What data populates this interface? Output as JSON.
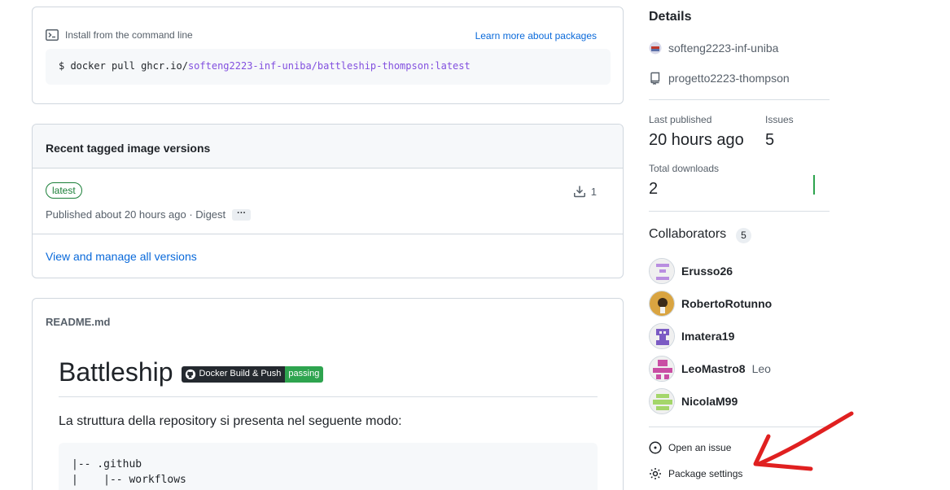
{
  "install": {
    "label": "Install from the command line",
    "learn_link": "Learn more about packages",
    "cmd_prefix": "$ docker pull ghcr.io/",
    "cmd_repo": "softeng2223-inf-uniba/battleship-thompson:latest"
  },
  "versions": {
    "title": "Recent tagged image versions",
    "tag": "latest",
    "published": "Published about 20 hours ago · Digest",
    "digest_btn": "···",
    "downloads": "1",
    "view_all": "View and manage all versions"
  },
  "readme": {
    "filename": "README.md",
    "title": "Battleship",
    "badge_left": "Docker Build & Push",
    "badge_right": "passing",
    "intro": "La struttura della repository si presenta nel seguente modo:",
    "code": "|-- .github\n|    |-- workflows"
  },
  "details": {
    "heading": "Details",
    "org": "softeng2223-inf-uniba",
    "repo": "progetto2223-thompson",
    "last_published_label": "Last published",
    "last_published_value": "20 hours ago",
    "issues_label": "Issues",
    "issues_value": "5",
    "downloads_label": "Total downloads",
    "downloads_value": "2"
  },
  "collaborators": {
    "heading": "Collaborators",
    "count": "5",
    "people": [
      {
        "login": "Erusso26",
        "name": "",
        "color": "#b98ee0"
      },
      {
        "login": "RobertoRotunno",
        "name": "",
        "color": "#d9a441"
      },
      {
        "login": "Imatera19",
        "name": "",
        "color": "#7b5bc4"
      },
      {
        "login": "LeoMastro8",
        "name": "Leo",
        "color": "#c94ea4"
      },
      {
        "login": "NicolaM99",
        "name": "",
        "color": "#a4d66a"
      }
    ]
  },
  "actions": {
    "open_issue": "Open an issue",
    "settings": "Package settings"
  },
  "colors": {
    "link": "#0969da",
    "success": "#1a7f37",
    "annotation": "#e02020"
  }
}
